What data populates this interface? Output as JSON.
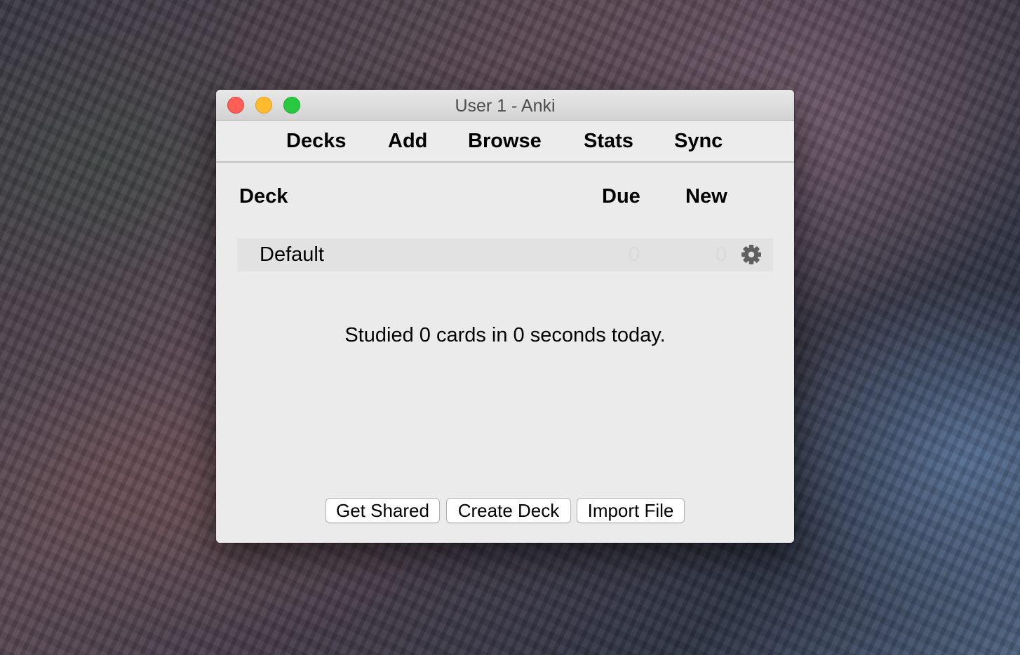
{
  "window": {
    "title": "User 1 - Anki"
  },
  "toolbar": {
    "items": [
      {
        "label": "Decks"
      },
      {
        "label": "Add"
      },
      {
        "label": "Browse"
      },
      {
        "label": "Stats"
      },
      {
        "label": "Sync"
      }
    ]
  },
  "deck_table": {
    "headers": {
      "deck": "Deck",
      "due": "Due",
      "new": "New"
    },
    "rows": [
      {
        "name": "Default",
        "due": "0",
        "new": "0",
        "options_icon": "gear-icon"
      }
    ]
  },
  "summary": {
    "studied_text": "Studied 0 cards in 0 seconds today."
  },
  "footer": {
    "buttons": [
      {
        "label": "Get Shared"
      },
      {
        "label": "Create Deck"
      },
      {
        "label": "Import File"
      }
    ]
  }
}
